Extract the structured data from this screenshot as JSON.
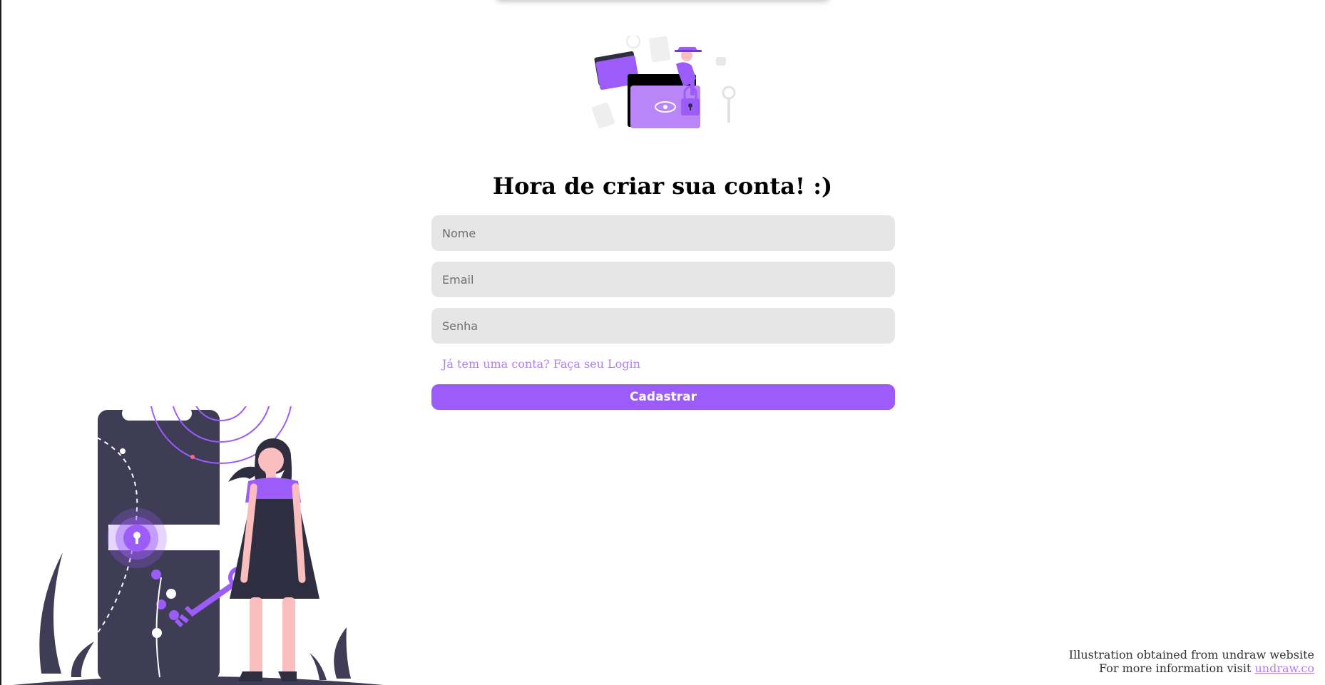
{
  "title": "Hora de criar sua conta! :)",
  "form": {
    "name_placeholder": "Nome",
    "email_placeholder": "Email",
    "password_placeholder": "Senha",
    "login_link": "Já tem uma conta? Faça seu Login",
    "submit_label": "Cadastrar"
  },
  "credit": {
    "line1": "Illustration obtained from undraw website",
    "line2_prefix": "For more information visit",
    "link_text": "undraw.co"
  },
  "colors": {
    "accent": "#9b5cfa",
    "link": "#b57bf5",
    "input_bg": "#e6e6e6",
    "dark": "#3f3d56"
  },
  "illustrations": {
    "hero": "secret-folder-illustration",
    "side": "woman-with-key-phone-lock-illustration"
  }
}
